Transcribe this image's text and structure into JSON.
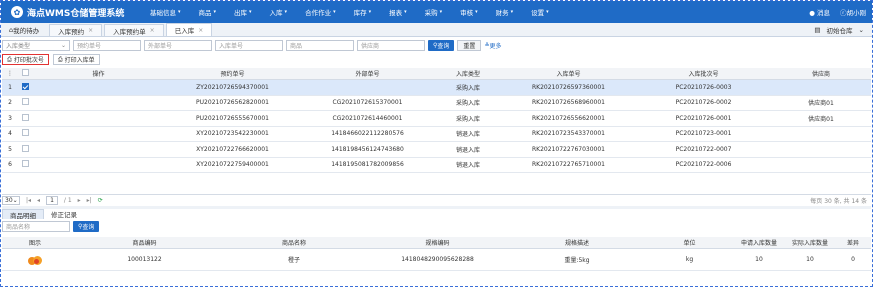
{
  "app": {
    "title": "海点WMS仓储管理系统"
  },
  "menu": [
    {
      "label": "基础信息"
    },
    {
      "label": "商品"
    },
    {
      "label": "出库"
    },
    {
      "label": "入库"
    },
    {
      "label": "合作作业"
    },
    {
      "label": "库存"
    },
    {
      "label": "报表"
    },
    {
      "label": "采购"
    },
    {
      "label": "审核"
    },
    {
      "label": "财务"
    },
    {
      "label": "设置"
    }
  ],
  "header_right": {
    "messages": "消息",
    "user": "胡小刚"
  },
  "tabs": [
    {
      "label": "我的待办"
    },
    {
      "label": "入库预约"
    },
    {
      "label": "入库预约单"
    },
    {
      "label": "已入库"
    }
  ],
  "warehouse": {
    "label": "初始仓库"
  },
  "search": {
    "type_select": "入库类型",
    "placeholders": [
      "预约单号",
      "外部单号",
      "入库单号",
      "商品",
      "供应商"
    ],
    "query_button": "查询",
    "reset_button": "重置",
    "more_link": "更多"
  },
  "toolbar": {
    "print_batch": "打印批次号",
    "print_inbound": "打印入库单"
  },
  "grid": {
    "columns": [
      "操作",
      "预约单号",
      "外部单号",
      "入库类型",
      "入库单号",
      "入库批次号",
      "供应商"
    ],
    "rows": [
      {
        "num": "1",
        "reservation": "ZY20210726594370001",
        "external": "",
        "type": "采购入库",
        "inbound": "RK20210726597360001",
        "batch": "PC20210726-0003",
        "supplier": ""
      },
      {
        "num": "2",
        "reservation": "PU20210726562820001",
        "external": "CG2021072615370001",
        "type": "采购入库",
        "inbound": "RK20210726568960001",
        "batch": "PC20210726-0002",
        "supplier": "供应商01"
      },
      {
        "num": "3",
        "reservation": "PU20210726555670001",
        "external": "CG2021072614460001",
        "type": "采购入库",
        "inbound": "RK20210726556620001",
        "batch": "PC20210726-0001",
        "supplier": "供应商01"
      },
      {
        "num": "4",
        "reservation": "XY20210723542230001",
        "external": "1418466022112280576",
        "type": "销退入库",
        "inbound": "RK20210723543370001",
        "batch": "PC20210723-0001",
        "supplier": ""
      },
      {
        "num": "5",
        "reservation": "XY20210722766620001",
        "external": "1418198456124743680",
        "type": "销退入库",
        "inbound": "RK20210722767030001",
        "batch": "PC20210722-0007",
        "supplier": ""
      },
      {
        "num": "6",
        "reservation": "XY20210722759400001",
        "external": "1418195081782009856",
        "type": "销退入库",
        "inbound": "RK20210722765710001",
        "batch": "PC20210722-0006",
        "supplier": ""
      }
    ]
  },
  "pager": {
    "page_size": "30",
    "page_input": "1",
    "page_total": "/ 1",
    "info": "每页 30 条, 共 14 条"
  },
  "subtabs": [
    {
      "label": "商品明细"
    },
    {
      "label": "修正记录"
    }
  ],
  "subsearch": {
    "placeholder": "商品名称",
    "button": "查询"
  },
  "detail": {
    "columns": [
      "图示",
      "商品编码",
      "商品名称",
      "规格编码",
      "规格描述",
      "单位",
      "申请入库数量",
      "实际入库数量",
      "差异"
    ],
    "row": {
      "code": "100013122",
      "name": "橙子",
      "spec_code": "1418048290095628288",
      "spec_desc": "重量:5kg",
      "unit": "kg",
      "applied": "10",
      "actual": "10",
      "diff": "0"
    }
  },
  "colors": {
    "primary": "#1f6bc6",
    "selected_row": "#dbe8fa",
    "highlight_border": "#e23232"
  }
}
